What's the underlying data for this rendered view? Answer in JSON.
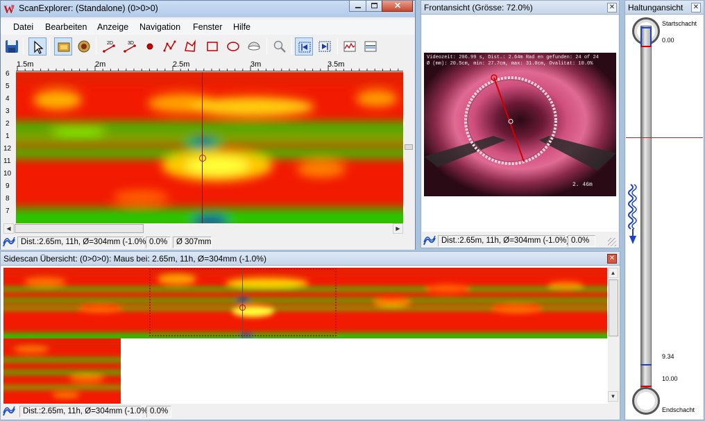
{
  "main_window": {
    "title": "ScanExplorer: (Standalone)  (0>0>0)",
    "menu": [
      "Datei",
      "Bearbeiten",
      "Anzeige",
      "Navigation",
      "Fenster",
      "Hilfe"
    ],
    "ruler": {
      "labels": [
        "1.5m",
        "2m",
        "2.5m",
        "3m",
        "3.5m"
      ]
    },
    "y_labels": [
      "6",
      "5",
      "4",
      "3",
      "2",
      "1",
      "12",
      "11",
      "10",
      "9",
      "8",
      "7"
    ],
    "toolbar": {
      "btn_2d": "2D",
      "btn_3d": "3D"
    },
    "status": {
      "dist": "Dist.:2.65m, 11h, Ø=304mm (-1.0%)",
      "pct": "0.0%",
      "diam": "Ø 307mm"
    }
  },
  "front_view": {
    "title": "Frontansicht (Grösse: 72.0%)",
    "overlay_line1": "Videozeit: 206.99 s, Dist.: 2.64m  Rad en gefunden: 24 of 24",
    "overlay_line2": "Ø (mm): 20.5cm, min: 27.7cm, max: 31.0cm, Ovalitat: 10.0%",
    "overlay_dist": "2. 46m",
    "status": {
      "dist": "Dist.:2.65m, 11h, Ø=304mm (-1.0%)",
      "pct": "0.0%"
    }
  },
  "haltung": {
    "title": "Haltungansicht",
    "start_label": "Startschacht",
    "end_label": "Endschacht",
    "top_value": "0.00",
    "value_934": "9.34",
    "value_1000": "10.00",
    "start_fraction": 0.0,
    "current_fraction": 0.265
  },
  "sidescan": {
    "title": "Sidescan Übersicht:  (0>0>0): Maus bei: 2.65m, 11h, Ø=304mm (-1.0%)",
    "status": {
      "dist": "Dist.:2.65m, 11h, Ø=304mm (-1.0%)",
      "pct": "0.0%"
    }
  },
  "colors": {
    "heat_red": "#f21a00",
    "heat_yellow": "#ffff33",
    "heat_green": "#22c400",
    "heat_blue": "#0a2fa8",
    "accent_blue": "#3a6fd8"
  },
  "icons": [
    "save-icon",
    "pointer-icon",
    "frame-icon",
    "circle-record-icon",
    "line-2d-icon",
    "line-3d-icon",
    "point-icon",
    "polyline-icon",
    "polygon-icon",
    "rectangle-icon",
    "ellipse-icon",
    "dome-icon",
    "magnifier-icon",
    "fit-left-icon",
    "fit-right-icon",
    "graph-icon",
    "profile-icon"
  ]
}
